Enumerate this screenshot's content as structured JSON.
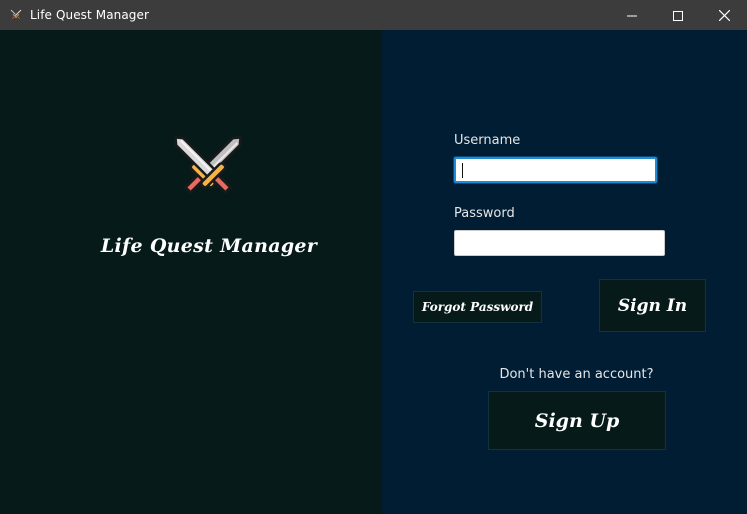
{
  "window": {
    "title": "Life Quest Manager",
    "icon": "crossed-swords-icon"
  },
  "titlebar_controls": {
    "minimize_icon": "minimize-icon",
    "maximize_icon": "maximize-icon",
    "close_icon": "close-icon"
  },
  "brand": {
    "logo_icon": "crossed-swords-icon",
    "name": "Life Quest Manager"
  },
  "login_form": {
    "username_label": "Username",
    "username_value": "",
    "password_label": "Password",
    "password_value": "",
    "forgot_password_label": "Forgot Password",
    "sign_in_label": "Sign In",
    "no_account_text": "Don't have an account?",
    "sign_up_label": "Sign Up"
  },
  "colors": {
    "titlebar_bg": "#3c3c3c",
    "left_panel_bg": "#071a1a",
    "right_panel_bg": "#001d33",
    "button_bg": "#071a1a",
    "focus_border": "#1f8ad6"
  }
}
